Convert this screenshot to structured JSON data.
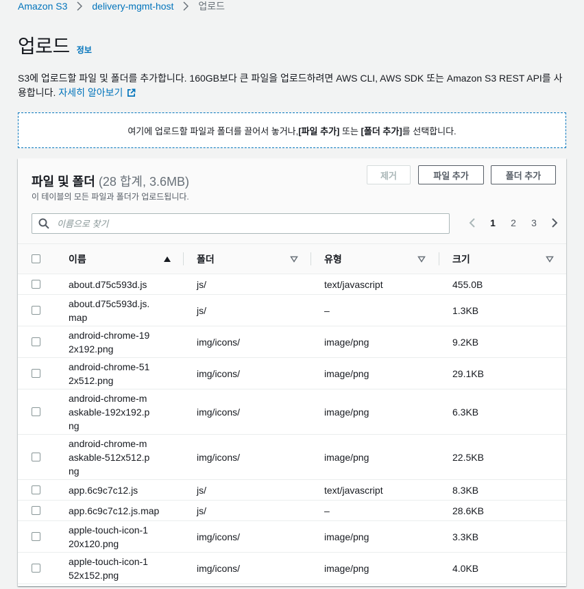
{
  "breadcrumb": {
    "items": [
      "Amazon S3",
      "delivery-mgmt-host"
    ],
    "current": "업로드"
  },
  "page": {
    "title": "업로드",
    "info_link": "정보",
    "description": "S3에 업로드할 파일 및 폴더를 추가합니다. 160GB보다 큰 파일을 업로드하려면 AWS CLI, AWS SDK 또는 Amazon S3 REST API를 사용합니다.",
    "learn_more": "자세히 알아보기"
  },
  "dropzone": {
    "text_pre": "여기에 업로드할 파일과 폴더를 끌어서 놓거나, ",
    "add_files": "[파일 추가]",
    "text_mid": " 또는 ",
    "add_folder": "[폴더 추가]",
    "text_post": "를 선택합니다."
  },
  "panel": {
    "title": "파일 및 폴더",
    "count": "(28 합계, 3.6MB)",
    "subtitle": "이 테이블의 모든 파일과 폴더가 업로드됩니다.",
    "remove_label": "제거",
    "add_files_label": "파일 추가",
    "add_folder_label": "폴더 추가",
    "search_placeholder": "이름으로 찾기",
    "pages": [
      "1",
      "2",
      "3"
    ],
    "current_page": "1"
  },
  "table": {
    "columns": [
      "이름",
      "폴더",
      "유형",
      "크기"
    ],
    "sort_column": "이름",
    "sort_direction": "ascending",
    "rows": [
      {
        "name": "about.d75c593d.js",
        "folder": "js/",
        "type": "text/javascript",
        "size": "455.0B"
      },
      {
        "name": "about.d75c593d.js.map",
        "folder": "js/",
        "type": "–",
        "size": "1.3KB"
      },
      {
        "name": "android-chrome-192x192.png",
        "folder": "img/icons/",
        "type": "image/png",
        "size": "9.2KB"
      },
      {
        "name": "android-chrome-512x512.png",
        "folder": "img/icons/",
        "type": "image/png",
        "size": "29.1KB"
      },
      {
        "name": "android-chrome-maskable-192x192.png",
        "folder": "img/icons/",
        "type": "image/png",
        "size": "6.3KB"
      },
      {
        "name": "android-chrome-maskable-512x512.png",
        "folder": "img/icons/",
        "type": "image/png",
        "size": "22.5KB"
      },
      {
        "name": "app.6c9c7c12.js",
        "folder": "js/",
        "type": "text/javascript",
        "size": "8.3KB"
      },
      {
        "name": "app.6c9c7c12.js.map",
        "folder": "js/",
        "type": "–",
        "size": "28.6KB"
      },
      {
        "name": "apple-touch-icon-120x120.png",
        "folder": "img/icons/",
        "type": "image/png",
        "size": "3.3KB"
      },
      {
        "name": "apple-touch-icon-152x152.png",
        "folder": "img/icons/",
        "type": "image/png",
        "size": "4.0KB"
      }
    ]
  },
  "colors": {
    "link": "#0073bb",
    "border": "#eaeded",
    "text": "#16191f",
    "muted": "#687078"
  }
}
